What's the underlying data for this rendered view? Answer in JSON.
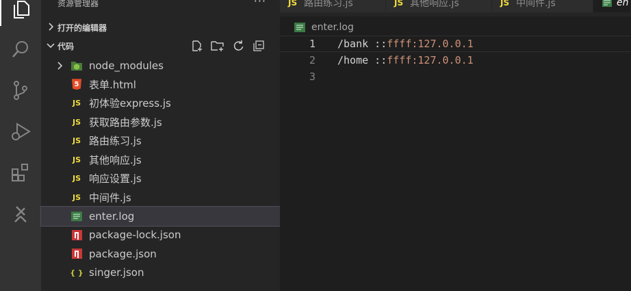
{
  "sidebar": {
    "title": "资源管理器",
    "more": "···",
    "open_editors_label": "打开的编辑器",
    "folder_label": "代码",
    "items": [
      {
        "label": "node_modules",
        "icon": "node-folder"
      },
      {
        "label": "表单.html",
        "icon": "html5",
        "badge": "5"
      },
      {
        "label": "初体验express.js",
        "icon": "js",
        "badge": "JS"
      },
      {
        "label": "获取路由参数.js",
        "icon": "js",
        "badge": "JS"
      },
      {
        "label": "路由练习.js",
        "icon": "js",
        "badge": "JS"
      },
      {
        "label": "其他响应.js",
        "icon": "js",
        "badge": "JS"
      },
      {
        "label": "响应设置.js",
        "icon": "js",
        "badge": "JS"
      },
      {
        "label": "中间件.js",
        "icon": "js",
        "badge": "JS"
      },
      {
        "label": "enter.log",
        "icon": "log"
      },
      {
        "label": "package-lock.json",
        "icon": "npm"
      },
      {
        "label": "package.json",
        "icon": "npm"
      },
      {
        "label": "singer.json",
        "icon": "json",
        "badge": "{ }"
      }
    ]
  },
  "tabs": [
    {
      "label": "路由练习.js",
      "badge": "JS"
    },
    {
      "label": "其他响应.js",
      "badge": "JS"
    },
    {
      "label": "中间件.js",
      "badge": "JS"
    },
    {
      "label": "en"
    }
  ],
  "breadcrumb": {
    "file": "enter.log"
  },
  "editor": {
    "lines": [
      {
        "num": "1",
        "path": "/bank",
        "sep": " ::",
        "addr": "ffff:127.0.0.1"
      },
      {
        "num": "2",
        "path": "/home",
        "sep": " ::",
        "addr": "ffff:127.0.0.1"
      },
      {
        "num": "3"
      }
    ]
  },
  "colors": {
    "accent": "#cb3837",
    "js": "#f1dd3f",
    "selection": "#37373d"
  }
}
